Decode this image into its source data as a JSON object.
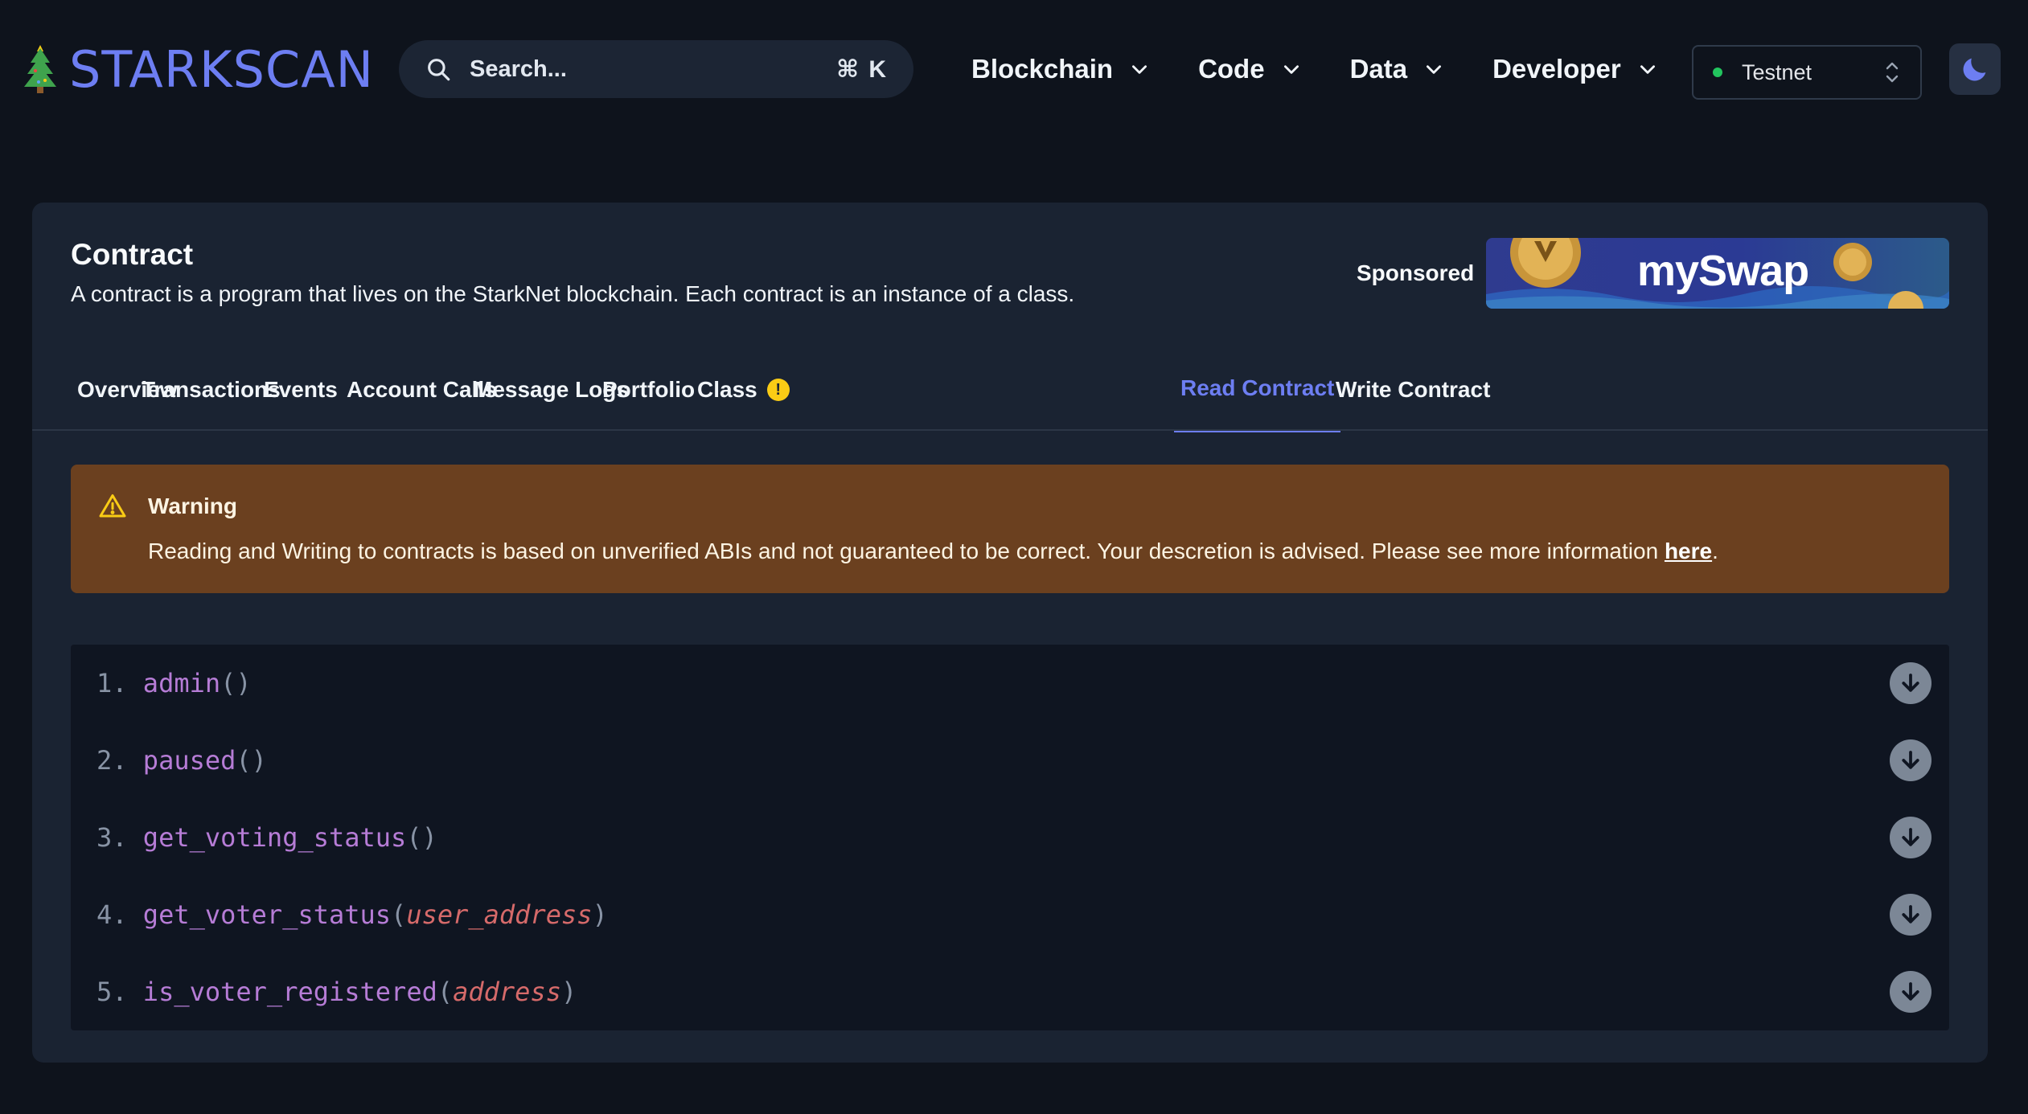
{
  "header": {
    "logo_text": "STARKSCAN",
    "search_placeholder": "Search...",
    "search_shortcut": "⌘ K",
    "nav": [
      {
        "label": "Blockchain"
      },
      {
        "label": "Code"
      },
      {
        "label": "Data"
      },
      {
        "label": "Developer"
      }
    ],
    "network": "Testnet",
    "network_status_color": "#22c55e",
    "theme_icon": "moon-icon"
  },
  "contract": {
    "title": "Contract",
    "description": "A contract is a program that lives on the StarkNet blockchain. Each contract is an instance of a class.",
    "sponsored_label": "Sponsored",
    "sponsor_name": "mySwap"
  },
  "tabs": [
    {
      "label": "Overview"
    },
    {
      "label": "Transactions"
    },
    {
      "label": "Events"
    },
    {
      "label": "Account Calls"
    },
    {
      "label": "Message Logs"
    },
    {
      "label": "Portfolio"
    },
    {
      "label": "Class",
      "badge": "!"
    },
    {
      "label": "Read Contract",
      "active": true
    },
    {
      "label": "Write Contract"
    }
  ],
  "warning": {
    "title": "Warning",
    "body": "Reading and Writing to contracts is based on unverified ABIs and not guaranteed to be correct. Your descretion is advised. Please see more information ",
    "link_text": "here",
    "trailing": "."
  },
  "functions": [
    {
      "num": "1.",
      "name": "admin",
      "open": "(",
      "args": "",
      "close": ")"
    },
    {
      "num": "2.",
      "name": "paused",
      "open": "(",
      "args": "",
      "close": ")"
    },
    {
      "num": "3.",
      "name": "get_voting_status",
      "open": "(",
      "args": "",
      "close": ")"
    },
    {
      "num": "4.",
      "name": "get_voter_status",
      "open": "(",
      "args": "user_address",
      "close": ")"
    },
    {
      "num": "5.",
      "name": "is_voter_registered",
      "open": "(",
      "args": "address",
      "close": ")"
    }
  ],
  "colors": {
    "accent": "#6d7ef2",
    "warning_bg": "#6b401f",
    "function_name": "#b67cd6",
    "function_arg": "#d66a6a"
  }
}
